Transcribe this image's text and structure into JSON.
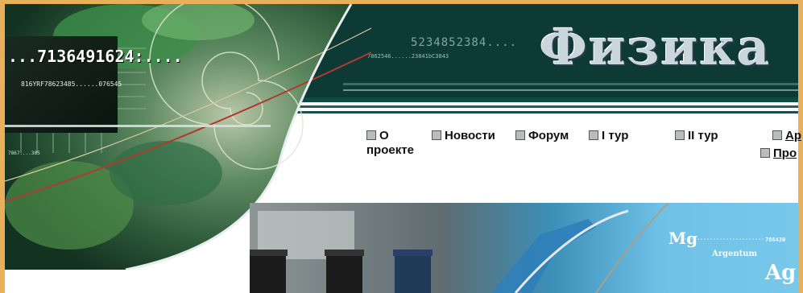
{
  "banner": {
    "logo": "Физика",
    "number_main": "5234852384....",
    "number_sub": "7862546......23841bC3843",
    "digits_big": "...7136491624:....",
    "digits_small": "816YRF78623485......076545",
    "digits_tiny": "7867....385"
  },
  "nav": {
    "items": [
      {
        "line1": "О",
        "line2": "проекте"
      },
      {
        "line1": "Новости"
      },
      {
        "line1": "Форум"
      },
      {
        "line1": "I тур"
      },
      {
        "line1": "II тур"
      },
      {
        "line1": "Ар"
      },
      {
        "line1": "Про"
      }
    ]
  },
  "lab": {
    "mg": "Mg",
    "argentum": "Argentum",
    "ag": "Ag",
    "mg_digits": "786430"
  },
  "colors": {
    "banner_bg": "#0d3a34",
    "frame": "#e8b05a",
    "lab_blue": "#6fc1e6"
  }
}
